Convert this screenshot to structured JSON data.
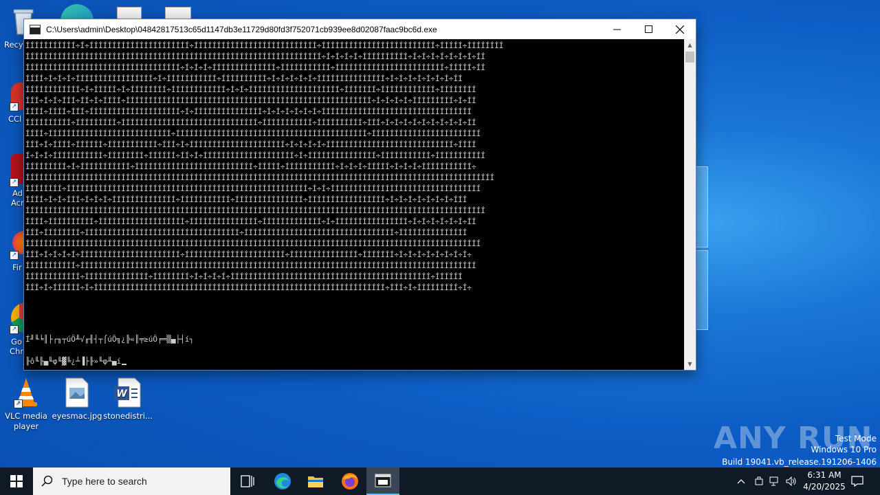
{
  "desktop": {
    "icons": [
      {
        "label": "VLC media player"
      },
      {
        "label": "eyesmac.jpg"
      },
      {
        "label": "stonedistri..."
      }
    ],
    "partial_labels": [
      "Recy",
      "CCl",
      "Ad",
      "Acr",
      "Fir",
      "Go",
      "Chr"
    ]
  },
  "console_window": {
    "title": "C:\\Users\\admin\\Desktop\\04842817513c65d1147db3e11729d80fd3f752071cb939ee8d02087faac9bc6d.exe",
    "lines": [
      "ÍÍÍÍÍÍÍÍÍÍÍ÷Í÷ÍÍÍÍÍÍÍÍÍÍÍÍÍÍÍÍÍÍÍÍÍÍ÷ÍÍÍÍÍÍÍÍÍÍÍÍÍÍÍÍÍÍÍÍÍÍÍÍÍÍÍ÷ÍÍÍÍÍÍÍÍÍÍÍÍÍÍÍÍÍÍÍÍÍÍÍÍÍ÷ÍÍÍÍÍ÷ÍÍÍÍÍÍÍÍ",
      "ÍÍÍÍÍÍÍÍÍÍÍÍÍÍÍÍÍÍÍÍÍÍÍÍÍÍÍÍÍÍÍÍÍÍÍÍÍÍÍÍÍÍÍÍÍÍÍÍÍÍÍÍÍÍÍÍÍÍÍÍÍÍÍÍÍ÷Í÷Í÷Í÷Í÷ÍÍÍÍÍÍÍÍÍÍ÷Í÷Í÷Í÷Í÷Í÷Í÷Í÷ÍÍ",
      "ÍÍÍÍÍÍÍÍÍÍÍÍÍÍÍÍÍÍÍÍÍÍÍÍÍÍÍÍÍÍÍÍÍÍ÷Í÷Í÷Í÷ÍÍÍÍÍÍÍÍÍÍÍÍÍÍ÷ÍÍÍÍÍÍÍÍÍÍÍ÷ÍÍÍÍÍÍÍÍÍÍÍÍÍÍÍÍÍÍÍÍÍÍÍÍ÷ÍÍÍÍÍ÷ÍÍ",
      "ÍÍÍÍ÷Í÷Í÷Í÷ÍÍÍÍÍÍÍÍÍÍÍÍÍÍÍÍÍ÷Í÷ÍÍÍÍÍÍÍÍÍÍÍ÷ÍÍÍÍÍÍÍÍÍÍ÷Í÷Í÷Í÷Í÷Í÷ÍÍÍÍÍÍÍÍÍÍÍÍÍÍÍ÷Í÷Í÷Í÷Í÷Í÷Í÷Í÷ÍÍ",
      "ÍÍÍÍÍÍÍÍÍÍÍÍ÷Í÷ÍÍÍÍÍ÷Í÷ÍÍÍÍÍÍÍÍ÷ÍÍÍÍÍÍÍÍÍÍÍÍ÷Í÷Í÷ÍÍÍÍÍÍÍÍÍÍÍÍÍÍÍÍÍÍÍÍ÷ÍÍÍÍÍÍÍ÷ÍÍÍÍÍÍÍÍÍÍÍÍ÷ÍÍÍÍÍÍÍÍ",
      "ÍÍÍ÷Í÷Í÷ÍÍÍ÷ÍÍ÷Í÷ÍÍÍÍ÷ÍÍÍÍÍÍÍÍÍÍÍÍÍÍÍÍÍÍÍÍÍÍÍÍÍÍÍÍÍÍÍÍÍÍÍÍÍÍÍÍÍÍÍÍÍÍÍÍÍÍÍÍÍÍ÷Í÷Í÷Í÷Í÷ÍÍÍÍÍÍÍÍÍ÷Í÷ÍÍ",
      "ÍÍÍÍ÷ÍÍÍÍ÷ÍÍÍ÷ÍÍÍÍÍÍÍÍÍÍÍÍÍÍÍÍÍÍÍÍ÷Í÷ÍÍÍÍÍÍÍÍÍÍÍÍÍÍÍ÷Í÷Í÷Í÷Í÷Í÷Í÷ÍÍÍÍÍÍÍÍÍÍÍÍÍÍÍÍÍÍÍÍÍÍÍÍÍÍÍÍÍÍÍÍÍ",
      "ÍÍÍÍÍÍÍÍÍÍ÷ÍÍÍÍÍÍÍÍÍ÷ÍÍÍÍÍÍÍÍÍÍÍÍÍÍÍÍÍÍÍÍÍÍÍÍÍÍÍÍÍÍ÷ÍÍÍÍÍÍÍÍÍÍÍ÷ÍÍÍÍÍÍÍÍÍÍ÷ÍÍÍ÷Í÷Í÷Í÷Í÷Í÷Í÷Í÷Í÷Í÷ÍÍ",
      "ÍÍÍÍ÷ÍÍÍÍÍÍÍÍÍÍÍÍÍÍÍÍÍÍÍÍÍÍÍÍÍÍÍ÷ÍÍÍÍÍÍÍÍÍÍÍÍÍÍÍÍÍÍÍÍÍÍÍÍÍÍÍÍÍÍÍÍÍÍÍÍÍÍÍÍÍÍ÷ÍÍÍÍÍÍÍÍÍÍÍÍÍÍÍÍÍÍÍÍÍÍÍÍ",
      "ÍÍÍ÷Í÷ÍÍÍÍ÷ÍÍÍÍÍÍ÷ÍÍÍÍÍÍÍÍÍÍÍ÷ÍÍÍ÷Í÷ÍÍÍÍÍÍÍÍÍÍÍÍÍÍÍÍÍÍÍÍÍ÷Í÷Í÷Í÷Í÷ÍÍÍÍÍÍÍÍÍÍÍÍÍÍÍÍÍÍÍÍÍÍÍÍÍÍÍÍ÷ÍÍÍÍ",
      "Í÷Í÷Í÷ÍÍÍÍÍÍÍÍÍÍÍ÷ÍÍÍÍÍÍÍÍ÷ÍÍÍÍÍÍ÷ÍÍ÷Í÷ÍÍÍÍÍÍÍÍÍÍÍÍÍÍÍÍÍÍÍÍ÷Í÷ÍÍÍÍÍÍÍÍÍÍÍÍÍÍÍ÷ÍÍÍÍÍÍÍÍÍÍÍ÷ÍÍÍÍÍÍÍÍÍÍÍ",
      "ÍÍÍÍÍÍÍÍÍ÷Í÷ÍÍÍÍÍÍÍÍÍÍÍ÷ÍÍÍÍÍÍÍÍÍÍÍÍÍÍÍÍÍÍÍÍÍÍÍÍÍÍ÷ÍÍÍÍÍ÷ÍÍÍÍÍÍÍÍÍÍÍ÷Í÷Í÷Í÷ÍÍÍÍÍ÷Í÷Í÷Í÷ÍÍÍÍÍÍÍÍÍÍÍ÷",
      "ÍÍÍÍÍÍÍÍÍÍÍÍÍÍÍÍÍÍÍÍÍÍÍÍÍÍÍÍÍÍÍÍÍÍÍÍÍÍÍÍÍÍÍÍÍÍÍÍÍÍÍÍÍÍÍÍÍÍÍÍÍÍÍÍÍÍÍÍÍÍÍÍÍÍÍÍÍÍÍÍÍÍÍÍÍÍÍÍÍÍÍÍÍÍÍÍÍÍÍÍÍÍÍ",
      "ÍÍÍÍÍÍÍÍ÷ÍÍÍÍÍÍÍÍÍÍÍÍÍÍÍÍÍÍÍÍÍÍÍÍÍÍÍÍÍÍÍÍÍÍÍÍÍÍÍÍÍÍÍÍÍÍÍÍÍÍÍÍÍ÷Í÷Í÷ÍÍÍÍÍÍÍÍÍÍÍÍÍÍÍÍÍÍÍÍÍÍÍÍÍÍÍÍÍÍÍÍÍ",
      "ÍÍÍÍ÷Í÷Í÷ÍÍÍ÷Í÷Í÷Í÷ÍÍÍÍÍÍÍÍÍÍÍÍÍÍ÷ÍÍÍÍÍÍÍÍÍÍÍ÷ÍÍÍÍÍÍÍÍÍÍÍÍÍÍÍ÷ÍÍÍÍÍÍÍÍÍÍÍÍÍÍÍÍÍ÷Í÷Í÷Í÷Í÷Í÷Í÷Í÷ÍÍÍ",
      "ÍÍÍÍÍÍÍÍÍÍÍÍÍÍÍÍÍÍÍÍÍÍÍÍÍÍÍÍÍÍÍÍÍÍÍÍÍÍÍÍÍÍÍÍÍÍÍÍÍÍÍÍÍÍÍÍÍÍÍÍÍÍÍÍÍÍÍÍÍÍÍÍÍÍÍÍÍÍÍÍÍÍÍÍÍÍÍÍÍÍÍÍÍÍÍÍÍÍÍÍÍ",
      "ÍÍÍÍ÷ÍÍÍÍÍÍÍÍÍÍ÷ÍÍÍÍÍÍÍÍÍÍÍÍÍÍÍÍÍÍÍ÷ÍÍÍÍÍÍÍÍÍÍÍÍÍÍÍ÷ÍÍÍÍÍÍÍÍÍÍÍÍÍ÷Í÷ÍÍÍÍÍÍÍÍÍÍÍÍÍÍÍÍ÷Í÷Í÷Í÷Í÷Í÷Í÷ÍÍ",
      "ÍÍÍ÷ÍÍÍÍÍÍÍÍ÷ÍÍÍÍÍÍÍÍÍÍÍÍÍÍÍÍÍÍÍÍÍÍÍÍÍÍÍÍÍÍÍÍÍÍ÷ÍÍÍÍÍÍÍÍÍÍÍÍÍÍÍÍÍÍÍÍÍÍÍÍÍÍÍÍÍÍÍÍÍ÷ÍÍÍÍÍÍÍÍÍÍÍÍÍÍÍ",
      "ÍÍÍÍÍÍÍÍÍÍÍÍÍÍÍÍÍÍÍÍÍÍÍÍÍÍÍÍÍÍÍÍÍÍÍÍÍÍÍÍÍÍÍÍÍÍÍÍÍÍÍÍÍÍÍÍÍÍÍÍÍÍÍÍÍÍÍÍÍÍÍÍÍÍÍÍÍÍÍÍÍÍÍÍÍÍÍÍÍÍÍÍÍÍÍÍÍÍÍÍ",
      "ÍÍÍ÷Í÷Í÷Í÷Í÷ÍÍÍÍÍÍÍÍÍÍÍÍÍÍÍÍÍÍÍÍÍÍ÷ÍÍÍÍÍÍÍÍÍÍÍÍÍÍÍÍÍÍÍÍÍÍ÷ÍÍÍÍÍÍÍÍÍÍÍÍÍÍÍ÷ÍÍÍÍÍÍÍ÷Í÷Í÷Í÷Í÷Í÷Í÷Í÷Í÷",
      "ÍÍÍÍÍÍÍÍÍÍÍ÷ÍÍÍÍÍÍÍÍÍÍÍÍÍÍÍÍÍÍÍÍÍÍÍÍÍÍÍÍÍÍÍÍÍÍÍÍÍÍÍÍÍÍÍÍÍÍÍÍÍÍÍÍÍÍÍÍÍÍÍÍÍÍÍÍÍÍÍÍÍÍÍÍÍÍÍÍÍÍÍÍÍÍÍÍÍÍÍ",
      "ÍÍÍÍÍÍÍÍÍÍÍÍ÷ÍÍÍÍÍÍÍÍÍÍÍÍÍÍ÷ÍÍÍÍÍÍÍÍ÷Í÷Í÷Í÷Í÷ÍÍÍÍÍÍÍÍÍÍÍÍÍÍÍÍÍÍÍÍÍÍÍÍÍÍÍÍÍÍÍÍÍÍÍÍÍÍÍÍÍÍÍÍ÷ÍÍÍÍÍÍ",
      "ÍÍÍ÷Í÷ÍÍÍÍÍÍ÷Í÷ÍÍÍÍÍÍÍÍÍÍÍÍÍÍÍÍÍÍÍÍÍÍÍÍÍÍÍÍÍÍÍÍÍÍÍÍÍÍÍÍÍÍÍÍÍÍÍÍÍÍÍÍÍÍÍÍÍÍÍÍÍÍÍÍ÷ÍÍÍ÷Í÷ÍÍÍÍÍÍÍÍÍ÷Í÷"
    ],
    "garble_line_1": "Í╜╙╘║├┌╖┬úÖ╨√╓╢┤┬⌠úÖ╗¿╠«║╤≥úÖ╒═▒▄├┤í┐",
    "garble_line_2": "╟ô╙╟▄╙φ╙▓╚¿┴▐├╟»╙φ╨▄í",
    "scroll_up": "▲",
    "scroll_down": "▼"
  },
  "watermark": {
    "logo_text": "ANY RUN",
    "lines": [
      "Test Mode",
      "Windows 10 Pro",
      "Build 19041.vb_release.191206-1406"
    ]
  },
  "taskbar": {
    "search_placeholder": "Type here to search",
    "clock_time": "6:31 AM",
    "clock_date": "4/20/2025"
  },
  "colors": {
    "console_bg": "#000000",
    "console_text": "#cfcfcf",
    "taskbar_bg": "#101a26",
    "desktop_accent": "#0c5cc4"
  }
}
